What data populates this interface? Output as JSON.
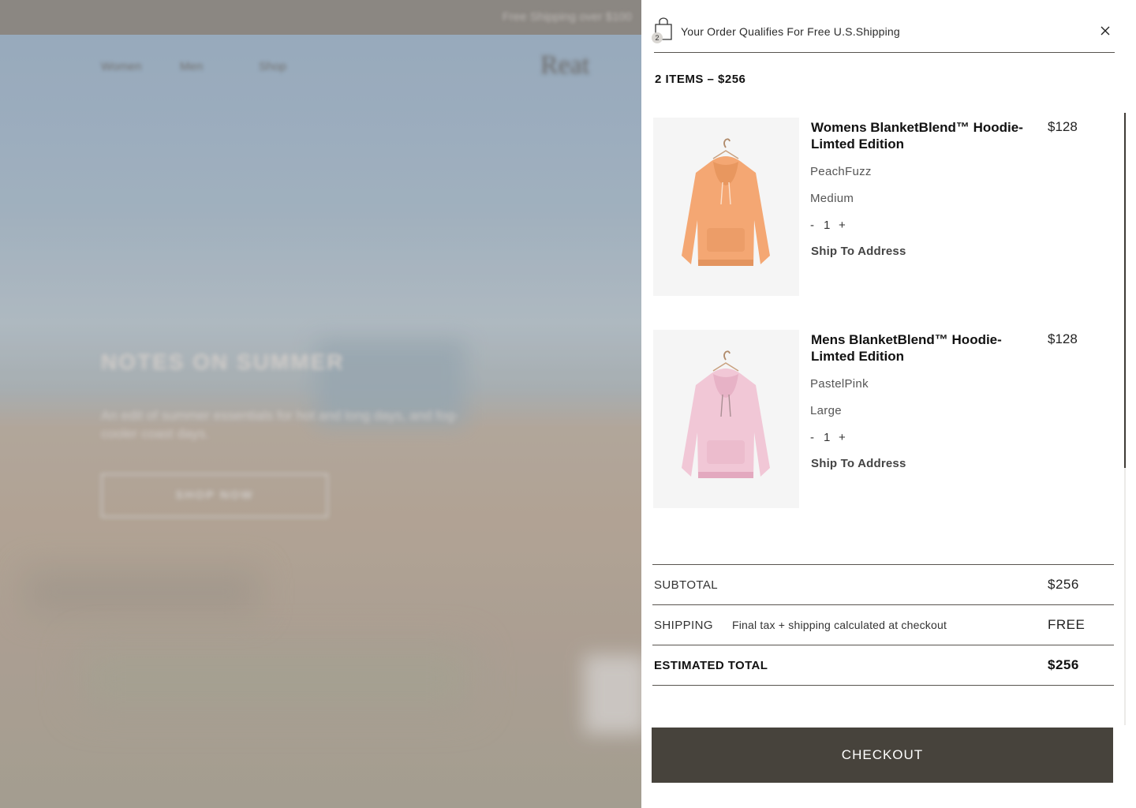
{
  "background_page": {
    "promo_text": "Free Shipping over $100",
    "nav": [
      "Women",
      "Men",
      "Shop"
    ],
    "logo": "Reat",
    "hero_title": "NOTES ON SUMMER",
    "hero_subtitle": "An edit of summer essentials for hot and long days, and fog-cooler coast days.",
    "hero_button": "SHOP NOW"
  },
  "drawer": {
    "bag_count": "2",
    "header_message": "Your Order Qualifies For Free U.S.Shipping",
    "items_summary": "2 ITEMS – $256",
    "items": [
      {
        "name": "Womens BlanketBlend™ Hoodie-Limted Edition",
        "price": "$128",
        "color": "PeachFuzz",
        "size": "Medium",
        "quantity": "1",
        "minus": "-",
        "plus": "+",
        "ship_option": "Ship To Address",
        "swatch": "#f4a773"
      },
      {
        "name": "Mens BlanketBlend™ Hoodie-Limted Edition",
        "price": "$128",
        "color": "PastelPink",
        "size": "Large",
        "quantity": "1",
        "minus": "-",
        "plus": "+",
        "ship_option": "Ship To Address",
        "swatch": "#f1c7d6"
      }
    ],
    "summary": {
      "subtotal_label": "SUBTOTAL",
      "subtotal_value": "$256",
      "shipping_label": "SHIPPING",
      "shipping_note": "Final tax + shipping calculated at checkout",
      "shipping_value": "FREE",
      "total_label": "ESTIMATED TOTAL",
      "total_value": "$256"
    },
    "checkout_label": "CHECKOUT",
    "colors": {
      "checkout_bg": "#47433c",
      "divider": "#58544f"
    }
  }
}
